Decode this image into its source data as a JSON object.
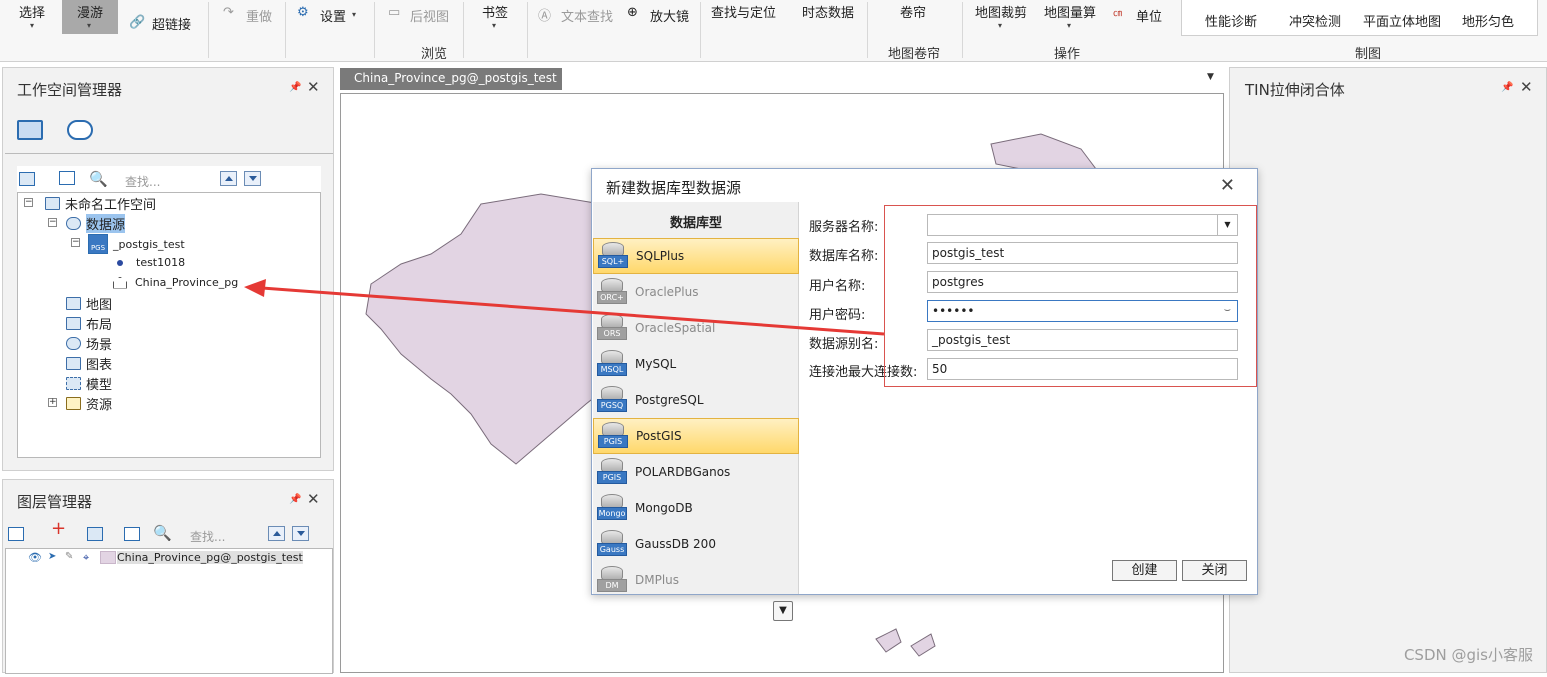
{
  "ribbon": {
    "select": "选择",
    "roam": "漫游",
    "hyperlink": "超链接",
    "redo": "重做",
    "settings": "设置",
    "back_view": "后视图",
    "bookmark": "书签",
    "text_find": "文本查找",
    "magnifier": "放大镜",
    "find_locate": "查找与定位",
    "temporal": "时态数据",
    "scroll": "卷帘",
    "map_clip": "地图裁剪",
    "map_measure": "地图量算",
    "unit": "单位",
    "perf": "性能诊断",
    "conflict": "冲突检测",
    "planar3d": "平面立体地图",
    "terrain_color": "地形匀色",
    "groups": {
      "browse": "浏览",
      "map_scroll": "地图卷帘",
      "operate": "操作",
      "drawing": "制图"
    }
  },
  "workspace": {
    "title": "工作空间管理器",
    "search_placeholder": "查找...",
    "tree": {
      "root": "未命名工作空间",
      "datasources": "数据源",
      "ds": "_postgis_test",
      "ds_tag": "PGS",
      "items": [
        "test1018",
        "China_Province_pg"
      ],
      "map": "地图",
      "layout": "布局",
      "scene": "场景",
      "chart": "图表",
      "model": "模型",
      "resource": "资源"
    }
  },
  "layers": {
    "title": "图层管理器",
    "search_placeholder": "查找...",
    "layer": "China_Province_pg@_postgis_test"
  },
  "map": {
    "tab": "China_Province_pg@_postgis_test",
    "tab_close": "×"
  },
  "right_panel": {
    "title": "TIN拉伸闭合体"
  },
  "dialog": {
    "title": "新建数据库型数据源",
    "list_header": "数据库型",
    "db_types": [
      {
        "name": "SQLPlus",
        "tag": "SQL+",
        "selected": true,
        "dim": false
      },
      {
        "name": "OraclePlus",
        "tag": "ORC+",
        "selected": false,
        "dim": true
      },
      {
        "name": "OracleSpatial",
        "tag": "ORS",
        "selected": false,
        "dim": true
      },
      {
        "name": "MySQL",
        "tag": "MSQL",
        "selected": false,
        "dim": false
      },
      {
        "name": "PostgreSQL",
        "tag": "PGSQ",
        "selected": false,
        "dim": false
      },
      {
        "name": "PostGIS",
        "tag": "PGIS",
        "selected": true,
        "dim": false
      },
      {
        "name": "POLARDBGanos",
        "tag": "PGIS",
        "selected": false,
        "dim": false
      },
      {
        "name": "MongoDB",
        "tag": "Mongo",
        "selected": false,
        "dim": false
      },
      {
        "name": "GaussDB 200",
        "tag": "Gauss",
        "selected": false,
        "dim": false
      },
      {
        "name": "DMPlus",
        "tag": "DM",
        "selected": false,
        "dim": true
      }
    ],
    "fields": {
      "server_label": "服务器名称:",
      "server_value": "",
      "db_label": "数据库名称:",
      "db_value": "postgis_test",
      "user_label": "用户名称:",
      "user_value": "postgres",
      "pwd_label": "用户密码:",
      "pwd_value": "••••••",
      "alias_label": "数据源别名:",
      "alias_value": "_postgis_test",
      "pool_label": "连接池最大连接数:",
      "pool_value": "50"
    },
    "create": "创建",
    "close": "关闭"
  },
  "watermark": "CSDN @gis小客服",
  "colors": {
    "accent": "#3a78c2",
    "selected": "#ffd86b",
    "annotation": "#e53935",
    "map_fill": "#e2d4e3"
  }
}
